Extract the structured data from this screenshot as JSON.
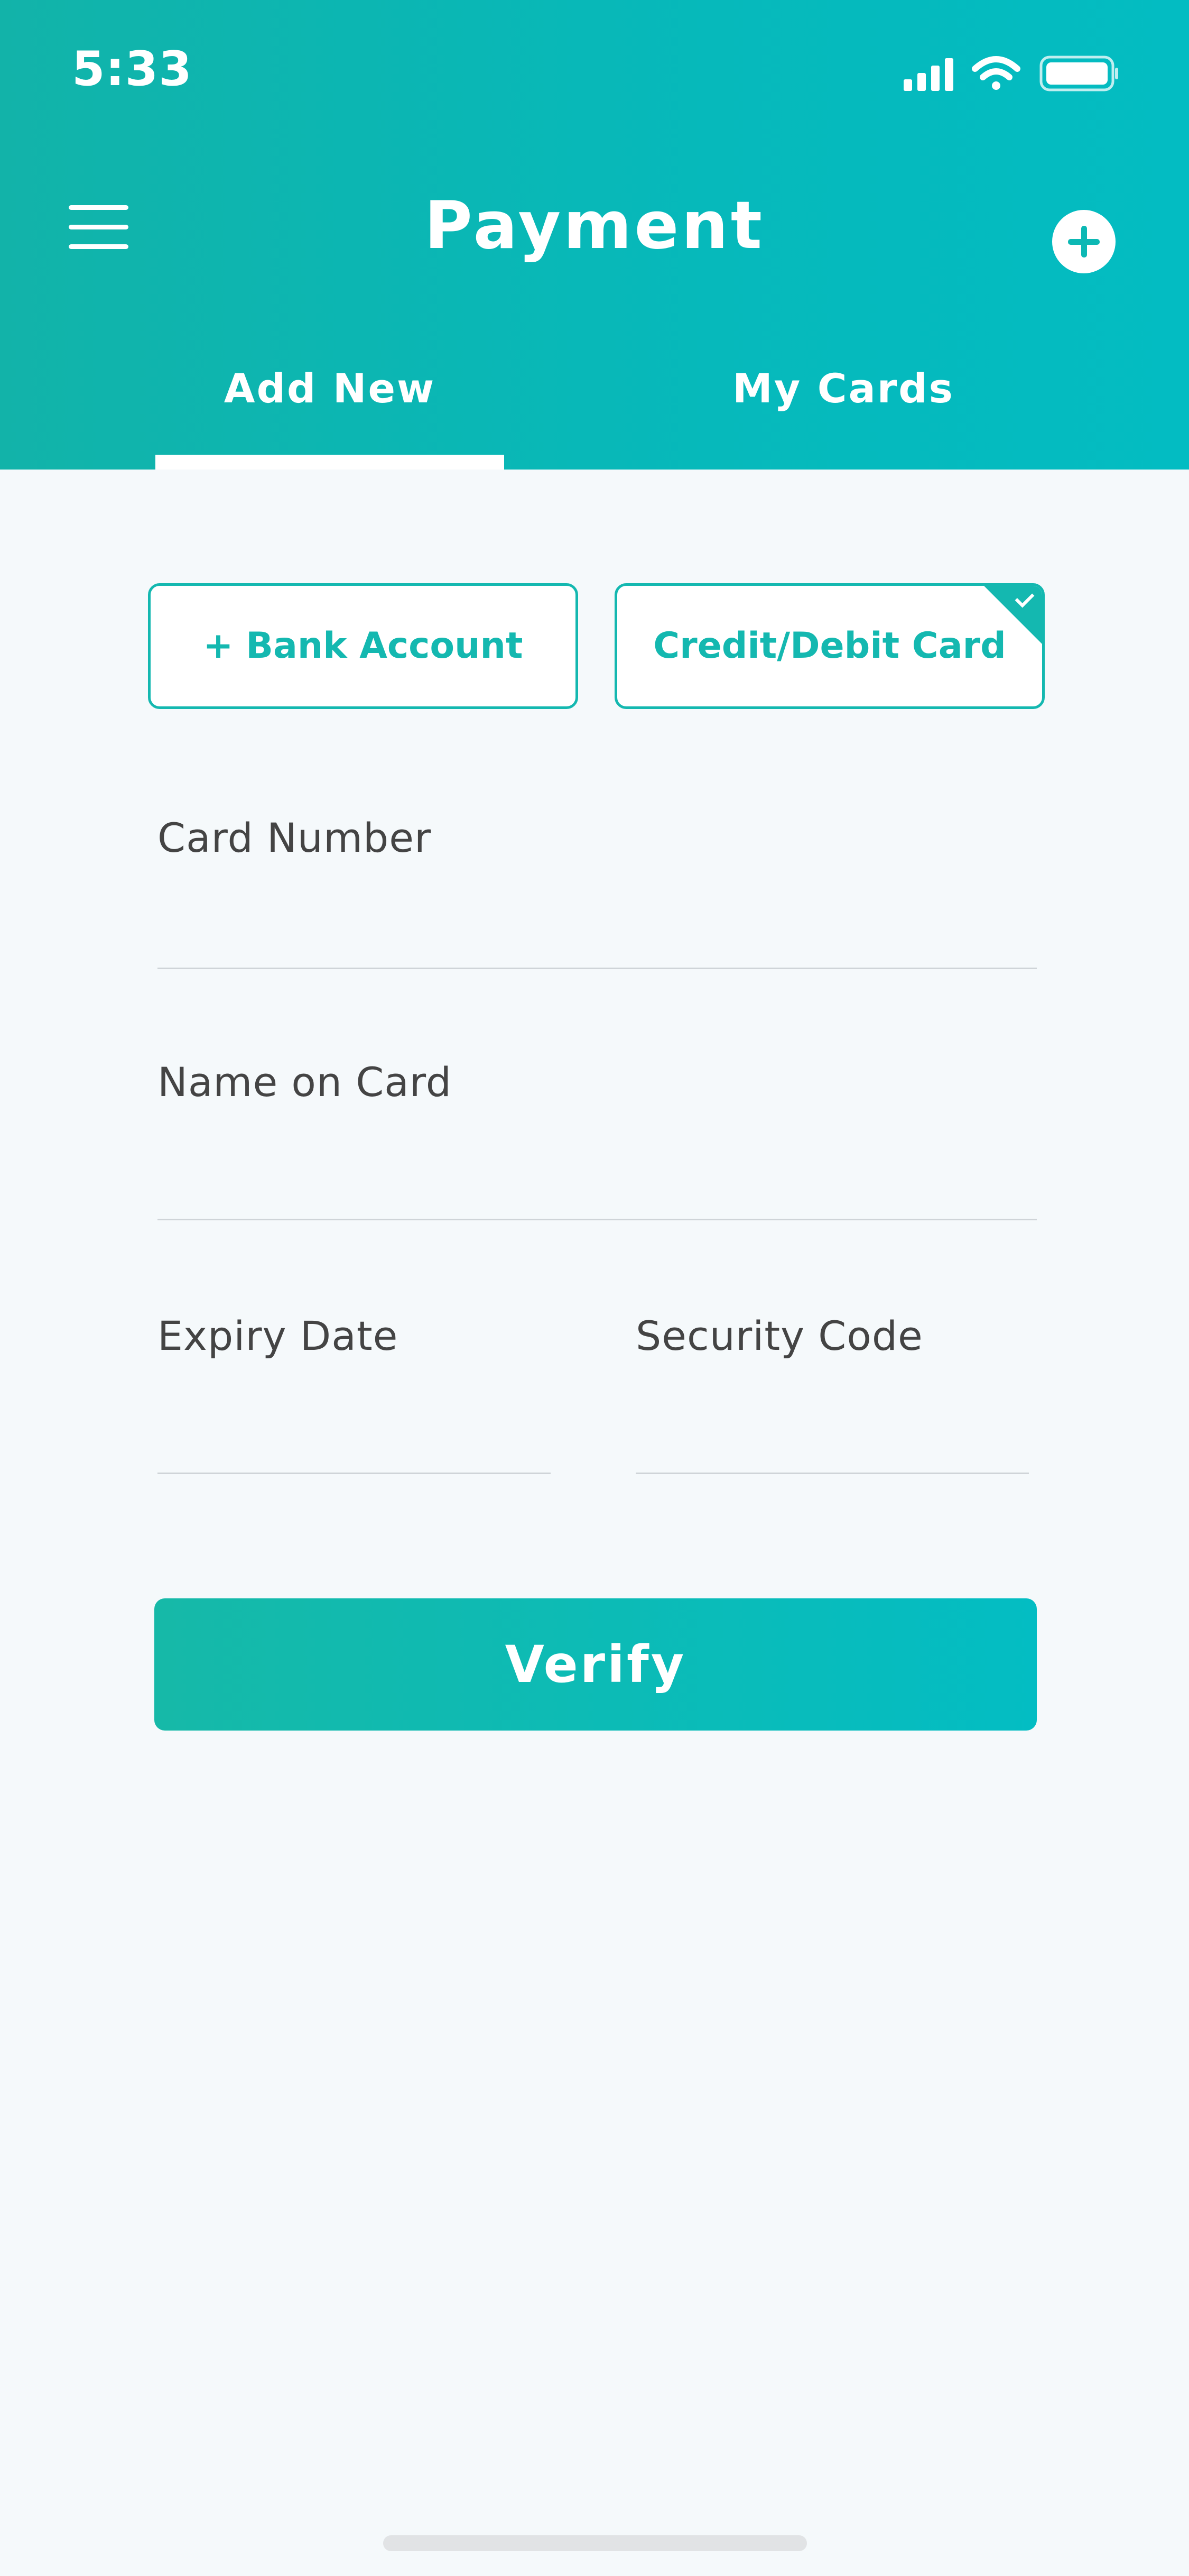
{
  "status_bar": {
    "time": "5:33"
  },
  "header": {
    "title": "Payment",
    "menu_icon": "hamburger-menu-icon",
    "add_icon": "plus-circle-icon",
    "tabs": [
      {
        "label": "Add New",
        "active": true
      },
      {
        "label": "My Cards",
        "active": false
      }
    ]
  },
  "options": {
    "bank_account": "+ Bank Account",
    "credit_debit_card": "Credit/Debit Card",
    "selected": "credit_debit_card"
  },
  "form": {
    "card_number_label": "Card Number",
    "card_number_value": "",
    "name_on_card_label": "Name on Card",
    "name_on_card_value": "",
    "expiry_date_label": "Expiry Date",
    "expiry_date_value": "",
    "security_code_label": "Security Code",
    "security_code_value": ""
  },
  "verify_button": "Verify",
  "colors": {
    "accent": "#14b8b0",
    "header_start": "#12b3a9",
    "header_end": "#03bcc2",
    "background": "#f5f9fb",
    "label_text": "#444444"
  }
}
